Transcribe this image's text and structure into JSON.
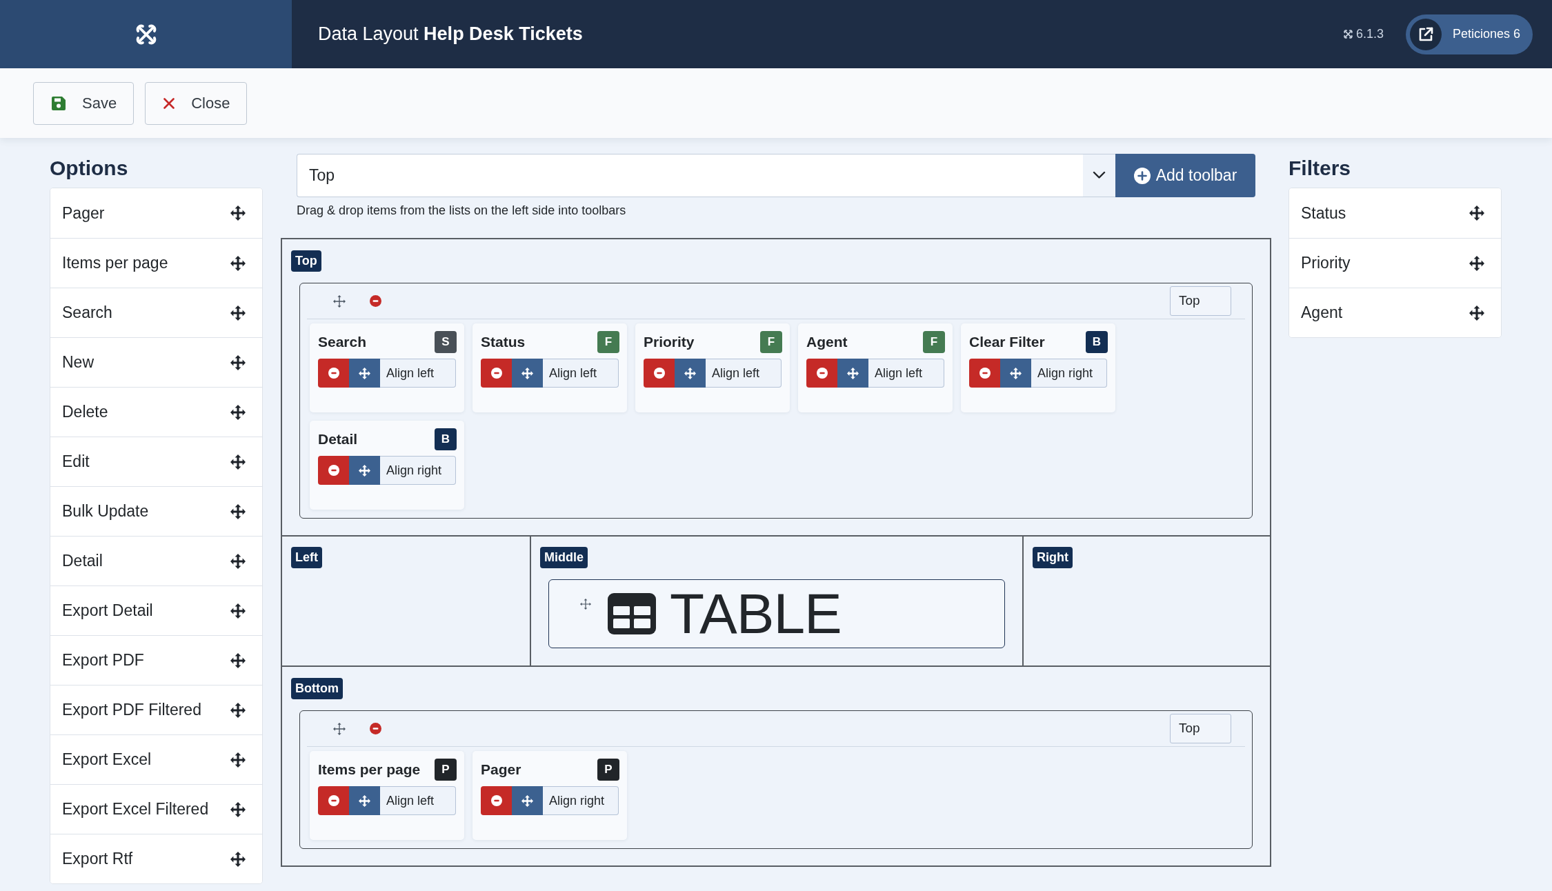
{
  "header": {
    "title": "Data Layout **Help Desk Tickets**",
    "version": "6.1.3",
    "site_link": "Peticiones 6"
  },
  "toolbar": [
    {
      "kind": "save",
      "label": "Save"
    },
    {
      "kind": "close",
      "label": "Close"
    }
  ],
  "options": {
    "title": "Options",
    "items": [
      "Pager",
      "Items per page",
      "Search",
      "New",
      "Delete",
      "Edit",
      "Bulk Update",
      "Detail",
      "Export Detail",
      "Export PDF",
      "Export PDF Filtered",
      "Export Excel",
      "Export Excel Filtered",
      "Export Rtf"
    ]
  },
  "toolbar_picker": {
    "value": "Top",
    "button": "Add toolbar",
    "hint": "Drag & drop items from the lists on the left side into toolbars"
  },
  "layout": {
    "top": {
      "label": "Top",
      "toolbars": [
        {
          "position": "Top",
          "items": [
            {
              "title": "Search",
              "badge": "S",
              "color": "#495057",
              "align": "Align left"
            },
            {
              "title": "Status",
              "badge": "F",
              "color": "#457b52",
              "align": "Align left"
            },
            {
              "title": "Priority",
              "badge": "F",
              "color": "#457b52",
              "align": "Align left"
            },
            {
              "title": "Agent",
              "badge": "F",
              "color": "#457b52",
              "align": "Align left"
            },
            {
              "title": "Clear Filter",
              "badge": "B",
              "color": "#132e53",
              "align": "Align right"
            },
            {
              "title": "Detail",
              "badge": "B",
              "color": "#132e53",
              "align": "Align right"
            }
          ]
        }
      ]
    },
    "columns": [
      {
        "label": "Left"
      },
      {
        "label": "Middle",
        "widget": "TABLE"
      },
      {
        "label": "Right"
      }
    ],
    "bottom": {
      "label": "Bottom",
      "toolbars": [
        {
          "position": "Top",
          "items": [
            {
              "title": "Items per page",
              "badge": "P",
              "color": "#212529",
              "align": "Align left"
            },
            {
              "title": "Pager",
              "badge": "P",
              "color": "#212529",
              "align": "Align right"
            }
          ]
        }
      ]
    }
  },
  "filters": {
    "title": "Filters",
    "items": [
      "Status",
      "Priority",
      "Agent"
    ]
  }
}
